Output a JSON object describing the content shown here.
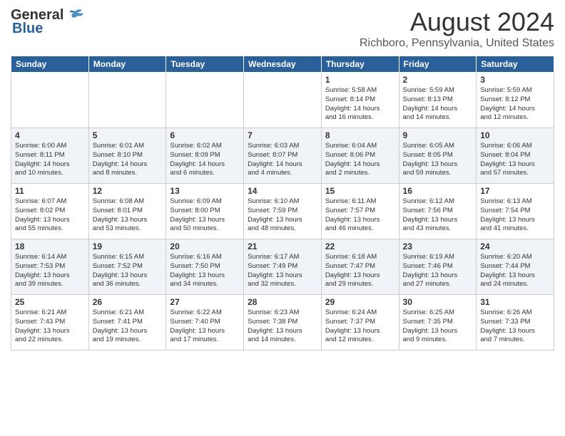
{
  "header": {
    "logo_general": "General",
    "logo_blue": "Blue",
    "month": "August 2024",
    "location": "Richboro, Pennsylvania, United States"
  },
  "weekdays": [
    "Sunday",
    "Monday",
    "Tuesday",
    "Wednesday",
    "Thursday",
    "Friday",
    "Saturday"
  ],
  "weeks": [
    [
      {
        "day": "",
        "info": ""
      },
      {
        "day": "",
        "info": ""
      },
      {
        "day": "",
        "info": ""
      },
      {
        "day": "",
        "info": ""
      },
      {
        "day": "1",
        "info": "Sunrise: 5:58 AM\nSunset: 8:14 PM\nDaylight: 14 hours\nand 16 minutes."
      },
      {
        "day": "2",
        "info": "Sunrise: 5:59 AM\nSunset: 8:13 PM\nDaylight: 14 hours\nand 14 minutes."
      },
      {
        "day": "3",
        "info": "Sunrise: 5:59 AM\nSunset: 8:12 PM\nDaylight: 14 hours\nand 12 minutes."
      }
    ],
    [
      {
        "day": "4",
        "info": "Sunrise: 6:00 AM\nSunset: 8:11 PM\nDaylight: 14 hours\nand 10 minutes."
      },
      {
        "day": "5",
        "info": "Sunrise: 6:01 AM\nSunset: 8:10 PM\nDaylight: 14 hours\nand 8 minutes."
      },
      {
        "day": "6",
        "info": "Sunrise: 6:02 AM\nSunset: 8:09 PM\nDaylight: 14 hours\nand 6 minutes."
      },
      {
        "day": "7",
        "info": "Sunrise: 6:03 AM\nSunset: 8:07 PM\nDaylight: 14 hours\nand 4 minutes."
      },
      {
        "day": "8",
        "info": "Sunrise: 6:04 AM\nSunset: 8:06 PM\nDaylight: 14 hours\nand 2 minutes."
      },
      {
        "day": "9",
        "info": "Sunrise: 6:05 AM\nSunset: 8:05 PM\nDaylight: 13 hours\nand 59 minutes."
      },
      {
        "day": "10",
        "info": "Sunrise: 6:06 AM\nSunset: 8:04 PM\nDaylight: 13 hours\nand 57 minutes."
      }
    ],
    [
      {
        "day": "11",
        "info": "Sunrise: 6:07 AM\nSunset: 8:02 PM\nDaylight: 13 hours\nand 55 minutes."
      },
      {
        "day": "12",
        "info": "Sunrise: 6:08 AM\nSunset: 8:01 PM\nDaylight: 13 hours\nand 53 minutes."
      },
      {
        "day": "13",
        "info": "Sunrise: 6:09 AM\nSunset: 8:00 PM\nDaylight: 13 hours\nand 50 minutes."
      },
      {
        "day": "14",
        "info": "Sunrise: 6:10 AM\nSunset: 7:59 PM\nDaylight: 13 hours\nand 48 minutes."
      },
      {
        "day": "15",
        "info": "Sunrise: 6:11 AM\nSunset: 7:57 PM\nDaylight: 13 hours\nand 46 minutes."
      },
      {
        "day": "16",
        "info": "Sunrise: 6:12 AM\nSunset: 7:56 PM\nDaylight: 13 hours\nand 43 minutes."
      },
      {
        "day": "17",
        "info": "Sunrise: 6:13 AM\nSunset: 7:54 PM\nDaylight: 13 hours\nand 41 minutes."
      }
    ],
    [
      {
        "day": "18",
        "info": "Sunrise: 6:14 AM\nSunset: 7:53 PM\nDaylight: 13 hours\nand 39 minutes."
      },
      {
        "day": "19",
        "info": "Sunrise: 6:15 AM\nSunset: 7:52 PM\nDaylight: 13 hours\nand 36 minutes."
      },
      {
        "day": "20",
        "info": "Sunrise: 6:16 AM\nSunset: 7:50 PM\nDaylight: 13 hours\nand 34 minutes."
      },
      {
        "day": "21",
        "info": "Sunrise: 6:17 AM\nSunset: 7:49 PM\nDaylight: 13 hours\nand 32 minutes."
      },
      {
        "day": "22",
        "info": "Sunrise: 6:18 AM\nSunset: 7:47 PM\nDaylight: 13 hours\nand 29 minutes."
      },
      {
        "day": "23",
        "info": "Sunrise: 6:19 AM\nSunset: 7:46 PM\nDaylight: 13 hours\nand 27 minutes."
      },
      {
        "day": "24",
        "info": "Sunrise: 6:20 AM\nSunset: 7:44 PM\nDaylight: 13 hours\nand 24 minutes."
      }
    ],
    [
      {
        "day": "25",
        "info": "Sunrise: 6:21 AM\nSunset: 7:43 PM\nDaylight: 13 hours\nand 22 minutes."
      },
      {
        "day": "26",
        "info": "Sunrise: 6:21 AM\nSunset: 7:41 PM\nDaylight: 13 hours\nand 19 minutes."
      },
      {
        "day": "27",
        "info": "Sunrise: 6:22 AM\nSunset: 7:40 PM\nDaylight: 13 hours\nand 17 minutes."
      },
      {
        "day": "28",
        "info": "Sunrise: 6:23 AM\nSunset: 7:38 PM\nDaylight: 13 hours\nand 14 minutes."
      },
      {
        "day": "29",
        "info": "Sunrise: 6:24 AM\nSunset: 7:37 PM\nDaylight: 13 hours\nand 12 minutes."
      },
      {
        "day": "30",
        "info": "Sunrise: 6:25 AM\nSunset: 7:35 PM\nDaylight: 13 hours\nand 9 minutes."
      },
      {
        "day": "31",
        "info": "Sunrise: 6:26 AM\nSunset: 7:33 PM\nDaylight: 13 hours\nand 7 minutes."
      }
    ]
  ]
}
